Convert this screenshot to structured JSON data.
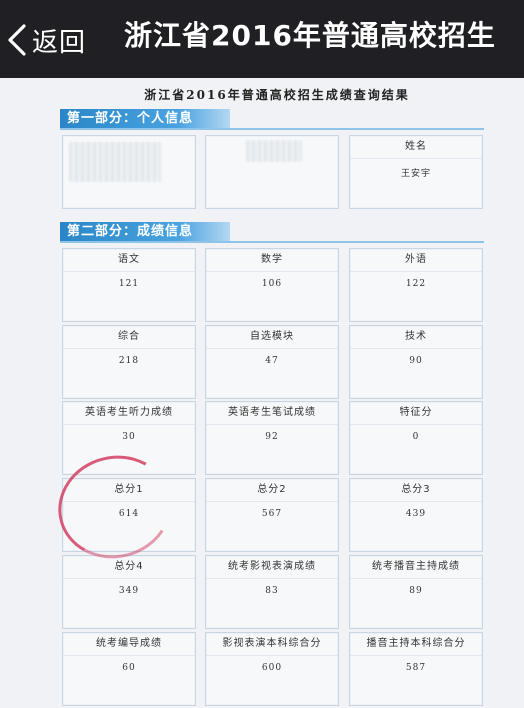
{
  "topbar": {
    "back_label": "返回",
    "title": "浙江省2016年普通高校招生"
  },
  "document": {
    "title": "浙江省2016年普通高校招生成绩查询结果",
    "section1": {
      "heading": "第一部分：个人信息",
      "name_label": "姓名",
      "name_value": "王安宇"
    },
    "section2": {
      "heading": "第二部分：成绩信息",
      "scores": [
        {
          "label": "语文",
          "value": "121"
        },
        {
          "label": "数学",
          "value": "106"
        },
        {
          "label": "外语",
          "value": "122"
        },
        {
          "label": "综合",
          "value": "218"
        },
        {
          "label": "自选模块",
          "value": "47"
        },
        {
          "label": "技术",
          "value": "90"
        },
        {
          "label": "英语考生听力成绩",
          "value": "30"
        },
        {
          "label": "英语考生笔试成绩",
          "value": "92"
        },
        {
          "label": "特征分",
          "value": "0"
        },
        {
          "label": "总分1",
          "value": "614"
        },
        {
          "label": "总分2",
          "value": "567"
        },
        {
          "label": "总分3",
          "value": "439"
        },
        {
          "label": "总分4",
          "value": "349"
        },
        {
          "label": "统考影视表演成绩",
          "value": "83"
        },
        {
          "label": "统考播音主持成绩",
          "value": "89"
        },
        {
          "label": "统考编导成绩",
          "value": "60"
        },
        {
          "label": "影视表演本科综合分",
          "value": "600"
        },
        {
          "label": "播音主持本科综合分",
          "value": "587"
        }
      ]
    }
  },
  "colors": {
    "topbar_bg": "#1f1f24",
    "section_header": "#2a86c7",
    "annotation_circle": "#d1355a"
  }
}
